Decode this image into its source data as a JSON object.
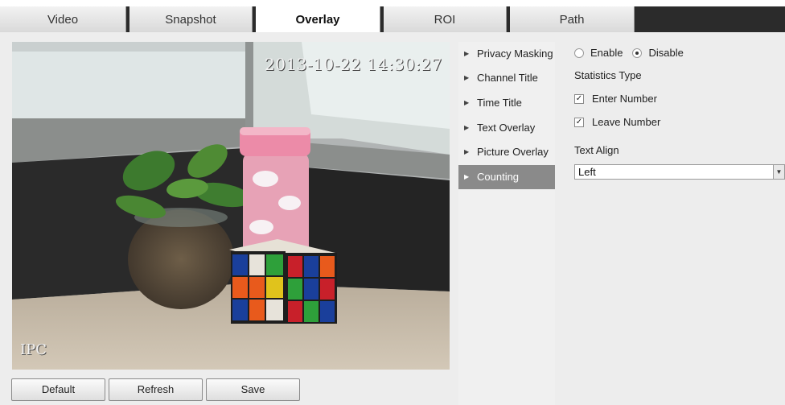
{
  "tabs": [
    {
      "label": "Video"
    },
    {
      "label": "Snapshot"
    },
    {
      "label": "Overlay"
    },
    {
      "label": "ROI"
    },
    {
      "label": "Path"
    }
  ],
  "active_tab": "Overlay",
  "video": {
    "timestamp": "2013-10-22 14:30:27",
    "channel_label": "IPC"
  },
  "buttons": {
    "default": "Default",
    "refresh": "Refresh",
    "save": "Save"
  },
  "menu": {
    "items": [
      {
        "label": "Privacy Masking"
      },
      {
        "label": "Channel Title"
      },
      {
        "label": "Time Title"
      },
      {
        "label": "Text Overlay"
      },
      {
        "label": "Picture Overlay"
      },
      {
        "label": "Counting"
      }
    ],
    "active": "Counting"
  },
  "settings": {
    "enable_label": "Enable",
    "disable_label": "Disable",
    "enable_selected": false,
    "statistics_type_label": "Statistics Type",
    "enter_number_label": "Enter Number",
    "enter_number_checked": true,
    "leave_number_label": "Leave Number",
    "leave_number_checked": true,
    "text_align_label": "Text Align",
    "text_align_value": "Left"
  }
}
